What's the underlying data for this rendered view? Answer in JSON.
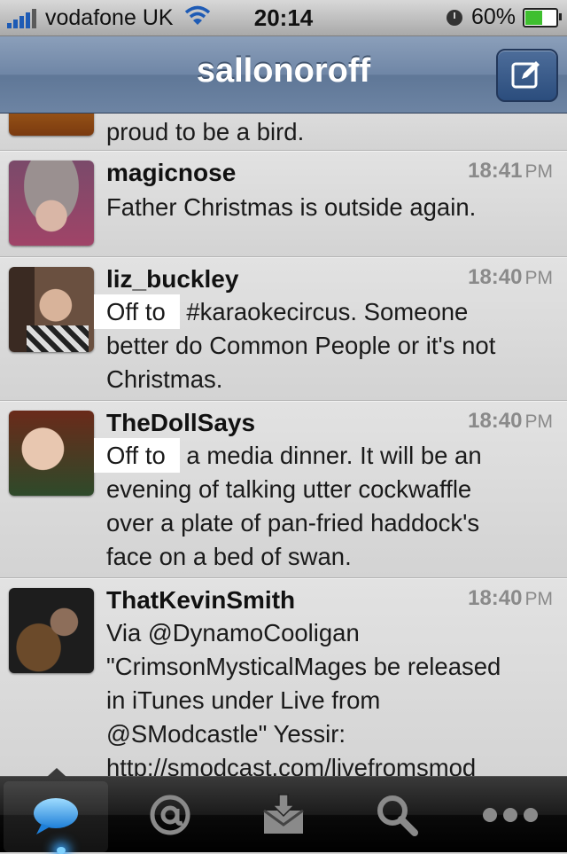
{
  "status_bar": {
    "carrier": "vodafone UK",
    "time": "20:14",
    "battery": "60%",
    "battery_level": 0.6
  },
  "nav": {
    "title": "sallonoroff",
    "compose_icon": "compose-icon"
  },
  "timeline": {
    "partial_tweet_text": "proud to be a bird.",
    "tweets": [
      {
        "user": "magicnose",
        "time": "18:41",
        "ampm": "PM",
        "lines": [
          "Father Christmas is outside again."
        ]
      },
      {
        "user": "liz_buckley",
        "time": "18:40",
        "ampm": "PM",
        "highlight": "Off to",
        "lines": [
          " #karaokecircus. Someone",
          "better do Common People or it's not",
          "Christmas."
        ]
      },
      {
        "user": "TheDollSays",
        "time": "18:40",
        "ampm": "PM",
        "highlight": "Off to",
        "lines": [
          " a media dinner. It will be an",
          "evening of talking utter cockwaffle",
          "over a plate of pan-fried haddock's",
          "face on a bed of swan."
        ]
      },
      {
        "user": "ThatKevinSmith",
        "time": "18:40",
        "ampm": "PM",
        "lines": [
          "Via @DynamoCooligan",
          "\"CrimsonMysticalMages be released",
          "in iTunes under Live from",
          "@SModcastle\" Yessir:",
          "http://smodcast.com/livefromsmod"
        ]
      }
    ]
  },
  "tab_bar": {
    "tabs": [
      "timeline-icon",
      "mentions-icon",
      "messages-icon",
      "search-icon",
      "more-icon"
    ],
    "active": 0
  }
}
